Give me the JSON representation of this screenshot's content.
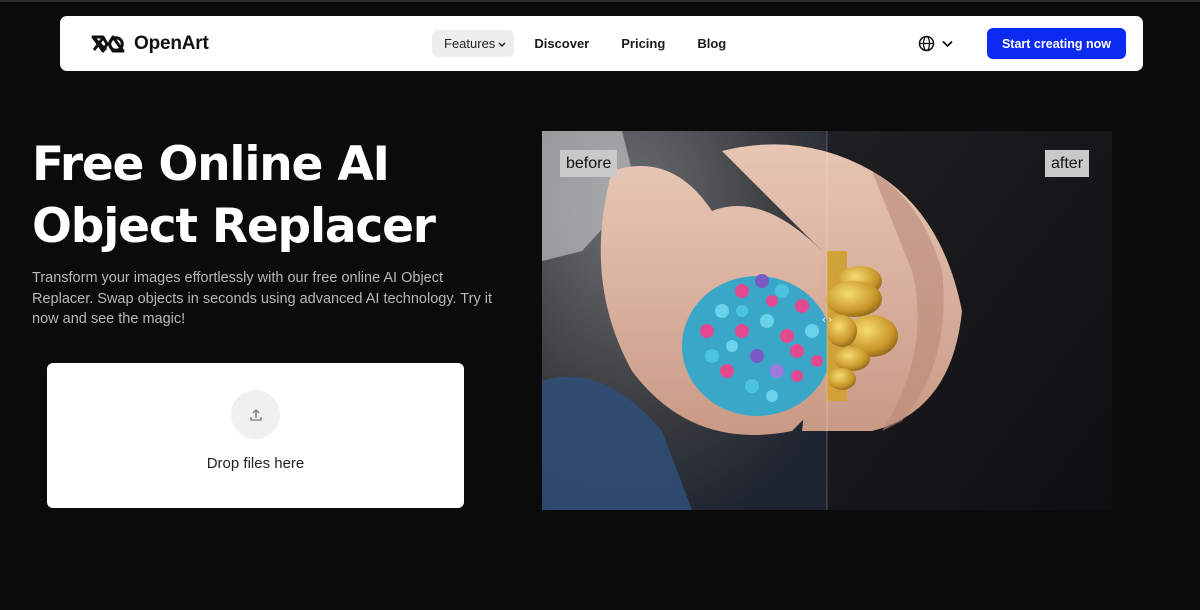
{
  "brand": {
    "name": "OpenArt"
  },
  "nav": {
    "items": [
      {
        "label": "Features",
        "has_dropdown": true,
        "active": true
      },
      {
        "label": "Discover"
      },
      {
        "label": "Pricing"
      },
      {
        "label": "Blog"
      }
    ],
    "language_icon": "globe-icon",
    "cta_label": "Start creating now"
  },
  "hero": {
    "title_line1": "Free Online AI",
    "title_line2": "Object Replacer",
    "description": "Transform your images effortlessly with our free online AI Object Replacer. Swap objects in seconds using advanced AI technology. Try it now and see the magic!"
  },
  "upload": {
    "icon": "upload-icon",
    "label": "Drop files here"
  },
  "compare": {
    "before_label": "before",
    "after_label": "after",
    "split_fraction": 0.5
  },
  "colors": {
    "background": "#0b0b0b",
    "accent": "#0b2cf0"
  }
}
